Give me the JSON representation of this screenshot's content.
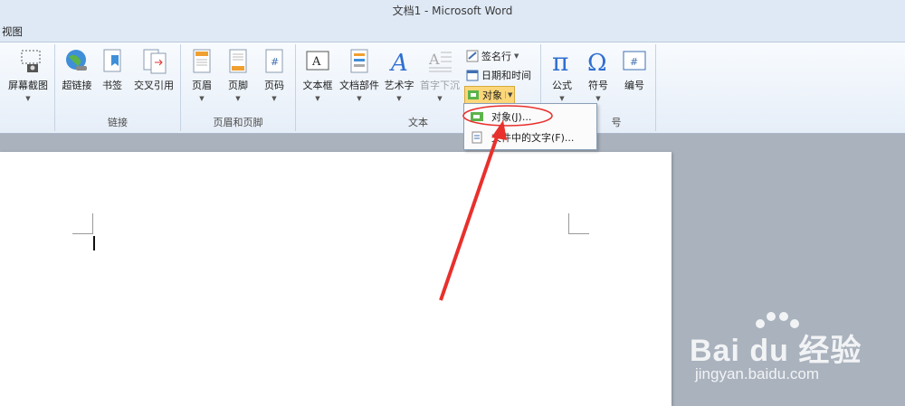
{
  "window": {
    "title": "文档1  -  Microsoft Word"
  },
  "tabs": {
    "view": "视图"
  },
  "ribbon": {
    "screenshot": {
      "label": "屏幕截图"
    },
    "links": {
      "hyperlink": "超链接",
      "bookmark": "书签",
      "cross_reference": "交叉引用",
      "group_label": "链接"
    },
    "header_footer": {
      "header": "页眉",
      "footer": "页脚",
      "page_number": "页码",
      "group_label": "页眉和页脚"
    },
    "text": {
      "textbox": "文本框",
      "quick_parts": "文档部件",
      "wordart": "艺术字",
      "dropcap": "首字下沉",
      "signature_line": "签名行",
      "date_time": "日期和时间",
      "object": "对象",
      "group_label": "文本"
    },
    "symbols": {
      "equation": "公式",
      "symbol": "符号",
      "number": "编号",
      "group_label_partial": "号"
    }
  },
  "object_menu": {
    "items": [
      {
        "label": "对象(J)..."
      },
      {
        "label": "文件中的文字(F)..."
      }
    ]
  },
  "watermark": {
    "brand": "Bai du 经验",
    "url": "jingyan.baidu.com"
  },
  "colors": {
    "annotation_red": "#e8302c",
    "ribbon_bg": "#e6eef8",
    "doc_bg": "#a9b2bd"
  }
}
